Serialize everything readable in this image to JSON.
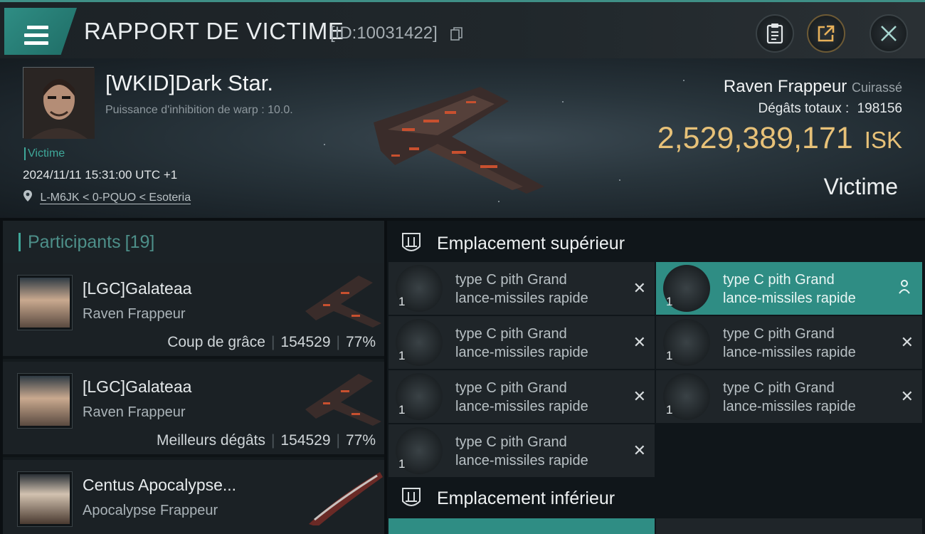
{
  "header": {
    "title": "RAPPORT DE VICTIME",
    "report_id": "[ID:10031422]"
  },
  "victim": {
    "name": "[WKID]Dark Star.",
    "subtitle": "Puissance d'inhibition de warp : 10.0.",
    "role_tag": "Victime",
    "datetime": "2024/11/11 15:31:00 UTC +1",
    "location": "L-M6JK < 0-PQUO < Esoteria",
    "ship_name": "Raven Frappeur",
    "ship_class": "Cuirassé",
    "damage_label": "Dégâts totaux :",
    "damage_value": "198156",
    "isk_value": "2,529,389,171",
    "isk_unit": "ISK",
    "role": "Victime"
  },
  "participants": {
    "label": "Participants",
    "count": "[19]",
    "rows": [
      {
        "name": "[LGC]Galateaa",
        "ship": "Raven Frappeur",
        "tag": "Coup de grâce",
        "damage": "154529",
        "percent": "77%"
      },
      {
        "name": "[LGC]Galateaa",
        "ship": "Raven Frappeur",
        "tag": "Meilleurs dégâts",
        "damage": "154529",
        "percent": "77%"
      },
      {
        "name": "Centus Apocalypse...",
        "ship": "Apocalypse Frappeur"
      }
    ]
  },
  "slots": {
    "high_title": "Emplacement supérieur",
    "low_title": "Emplacement inférieur",
    "items": [
      {
        "line1": "type C pith Grand",
        "line2": "lance-missiles rapide",
        "qty": "1"
      },
      {
        "line1": "type C pith Grand",
        "line2": "lance-missiles rapide",
        "qty": "1"
      },
      {
        "line1": "type C pith Grand",
        "line2": "lance-missiles rapide",
        "qty": "1"
      },
      {
        "line1": "type C pith Grand",
        "line2": "lance-missiles rapide",
        "qty": "1"
      },
      {
        "line1": "type C pith Grand",
        "line2": "lance-missiles rapide",
        "qty": "1"
      },
      {
        "line1": "type C pith Grand",
        "line2": "lance-missiles rapide",
        "qty": "1"
      },
      {
        "line1": "type C pith Grand",
        "line2": "lance-missiles rapide",
        "qty": "1"
      }
    ],
    "close_glyph": "✕"
  },
  "colors": {
    "accent": "#2f8d84",
    "isk_gold": "#e7c178",
    "panel": "#1f2529"
  },
  "icons": [
    "menu-icon",
    "copy-icon",
    "clipboard-icon",
    "share-icon",
    "close-icon",
    "location-pin-icon",
    "slot-shield-icon",
    "launcher-icon",
    "pilot-icon"
  ]
}
